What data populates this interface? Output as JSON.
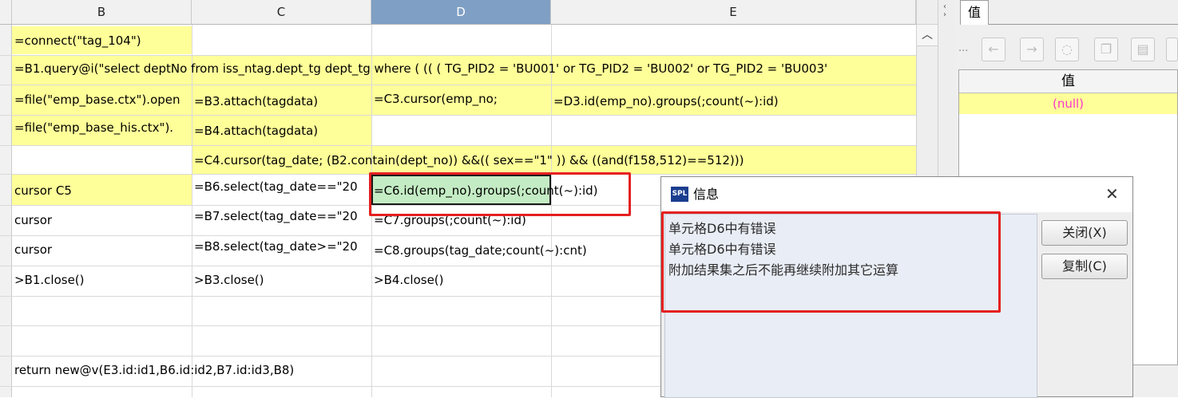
{
  "sheet": {
    "columns": [
      "B",
      "C",
      "D",
      "E"
    ],
    "selected_column": "D",
    "cells": {
      "B1": "=connect(\"tag_104\")",
      "B2": "=B1.query@i(\"select deptNo from iss_ntag.dept_tg dept_tg where   ( (( ( TG_PID2 = 'BU001'  or TG_PID2 = 'BU002'  or TG_PID2 = 'BU003'",
      "B3": "=file(\"emp_base.ctx\").open",
      "C3": "=B3.attach(tagdata)",
      "D3": "=C3.cursor(emp_no;",
      "E3": "=D3.id(emp_no).groups(;count(~):id)",
      "B4": "=file(\"emp_base_his.ctx\").",
      "C4": "=B4.attach(tagdata)",
      "C5": "=C4.cursor(tag_date; (B2.contain(dept_no)) &&(( sex==\"1\" )) &&  ((and(f158,512)==512)))",
      "B6": "cursor C5",
      "C6": "=B6.select(tag_date==\"20",
      "D6": "=C6.id(emp_no).groups(;count(~):id)",
      "B7": "cursor",
      "C7": "=B7.select(tag_date==\"20",
      "D7": "=C7.groups(;count(~):id)",
      "B8": "cursor",
      "C8": "=B8.select(tag_date>=\"20",
      "D8": "=C8.groups(tag_date;count(~):cnt)",
      "B9": ">B1.close()",
      "C9": ">B3.close()",
      "D9": ">B4.close()",
      "B12": "return new@v(E3.id:id1,B6.id:id2,B7.id:id3,B8)"
    }
  },
  "right_panel": {
    "tab_label": "值",
    "dots": "...",
    "table_header": "值",
    "null_value": "(null)",
    "null_color": "#ff33cc"
  },
  "dialog": {
    "logo": "SPL",
    "title": "信息",
    "close_glyph": "✕",
    "messages": [
      "单元格D6中有错误",
      "单元格D6中有错误",
      "附加结果集之后不能再继续附加其它运算"
    ],
    "buttons": {
      "close": "关闭(X)",
      "copy": "复制(C)"
    }
  },
  "colors": {
    "cell_yellow": "#ffff99",
    "selected_cell": "#c4ecc4",
    "selected_column_header": "#7f9fc4",
    "highlight_box": "#e52020"
  }
}
